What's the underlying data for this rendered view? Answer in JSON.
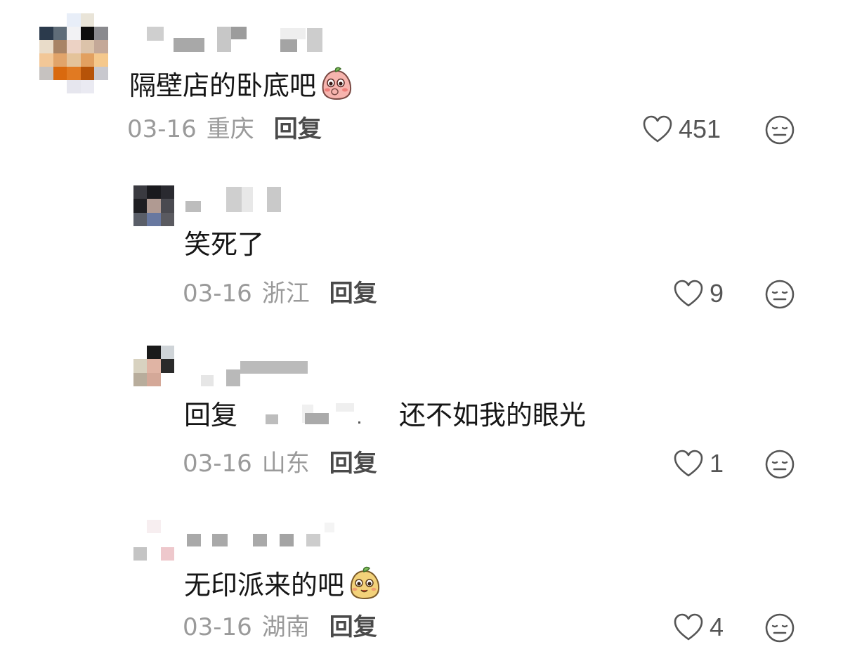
{
  "comments": [
    {
      "username": "████",
      "text": "隔壁店的卧底吧",
      "emoji": "peach-cover-mouth-emoji",
      "date": "03-16",
      "region": "重庆",
      "reply_label": "回复",
      "likes": "451"
    },
    {
      "username": "███",
      "text": "笑死了",
      "date": "03-16",
      "region": "浙江",
      "reply_label": "回复",
      "likes": "9"
    },
    {
      "username": "████",
      "reply_prefix": "回复",
      "reply_to": "███",
      "text": "还不如我的眼光",
      "date": "03-16",
      "region": "山东",
      "reply_label": "回复",
      "likes": "1"
    },
    {
      "username": "█████",
      "text": "无印派来的吧",
      "emoji": "potato-smug-emoji",
      "date": "03-16",
      "region": "湖南",
      "reply_label": "回复",
      "likes": "4"
    }
  ],
  "colors": {
    "text": "#161616",
    "meta": "#9a9a9a",
    "reply": "#4a4a4a",
    "icon": "#555555"
  }
}
